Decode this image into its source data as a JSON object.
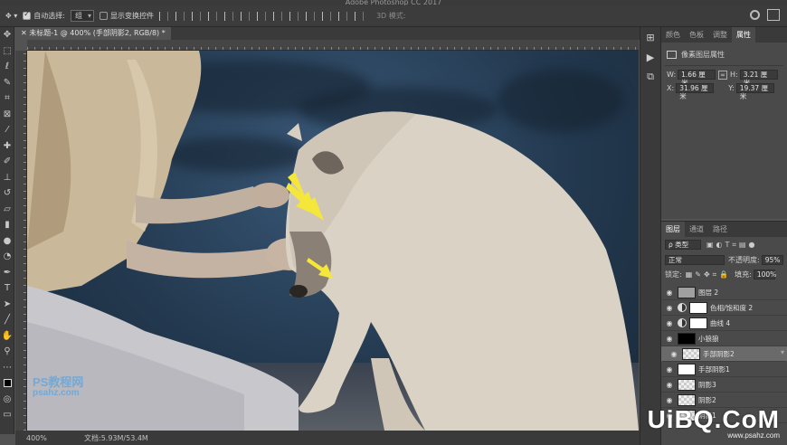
{
  "app": {
    "title": "Adobe Photoshop CC 2017"
  },
  "options_bar": {
    "auto_select_label": "自动选择:",
    "auto_select_value": "组",
    "show_transform_label": "显示变换控件",
    "mode_3d_label": "3D 模式:"
  },
  "document": {
    "tab_title": "未标题-1 @ 400% (手部阴影2, RGB/8) *",
    "zoom": "400%",
    "doc_size": "文档:5.93M/53.4M"
  },
  "properties_panel": {
    "tabs": [
      "颜色",
      "色板",
      "调整",
      "属性"
    ],
    "active_tab": "属性",
    "header": "像素图层属性",
    "w_label": "W:",
    "w_value": "1.66 厘米",
    "h_label": "H:",
    "h_value": "3.21 厘米",
    "x_label": "X:",
    "x_value": "31.96 厘米",
    "y_label": "Y:",
    "y_value": "19.37 厘米"
  },
  "layers_panel": {
    "tabs": [
      "图层",
      "通道",
      "路径"
    ],
    "filter_label": "ρ 类型",
    "blend_mode": "正常",
    "opacity_label": "不透明度:",
    "opacity_value": "95%",
    "lock_label": "锁定:",
    "fill_label": "填充:",
    "fill_value": "100%",
    "layers": [
      {
        "name": "图层 2",
        "visible": true,
        "selected": false,
        "thumb": "gray"
      },
      {
        "name": "色相/饱和度 2",
        "visible": true,
        "selected": false,
        "thumb": "white"
      },
      {
        "name": "曲线 4",
        "visible": true,
        "selected": false,
        "thumb": "white"
      },
      {
        "name": "小狼狼",
        "visible": true,
        "selected": false,
        "thumb": "black"
      },
      {
        "name": "手部阴影2",
        "visible": true,
        "selected": true,
        "thumb": "checker"
      },
      {
        "name": "手部阴影1",
        "visible": true,
        "selected": false,
        "thumb": "white"
      },
      {
        "name": "阴影3",
        "visible": true,
        "selected": false,
        "thumb": "checker"
      },
      {
        "name": "阴影2",
        "visible": true,
        "selected": false,
        "thumb": "checker"
      },
      {
        "name": "阴影1",
        "visible": true,
        "selected": false,
        "thumb": "checker"
      }
    ]
  },
  "watermarks": {
    "uibq": "UiBQ.CoM",
    "uibq_sub": "www.psahz.com",
    "left_logo_1": "PS教程网",
    "left_logo_2": "psahz.com"
  },
  "colors": {
    "ui_dark": "#3a3a3a",
    "panel": "#4a4a4a",
    "arrow_yellow": "#f5e63a",
    "sky_blue": "#2b4563"
  }
}
